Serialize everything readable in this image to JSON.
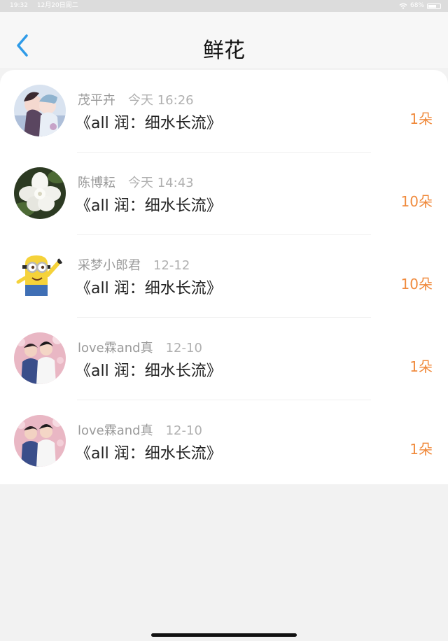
{
  "status_bar": {
    "time": "19:32",
    "date": "12月20日周二",
    "battery": "68%",
    "battery_level": 0.68
  },
  "nav": {
    "title": "鲜花"
  },
  "gifts": [
    {
      "user": "茂平卉",
      "time": "今天 16:26",
      "book": "《all 润：细水长流》",
      "count": "1朵",
      "avatar": "anime-couple-avatar"
    },
    {
      "user": "陈博耘",
      "time": "今天 14:43",
      "book": "《all 润：细水长流》",
      "count": "10朵",
      "avatar": "white-flower-avatar"
    },
    {
      "user": "采梦小郎君",
      "time": "12-12",
      "book": "《all 润：细水长流》",
      "count": "10朵",
      "avatar": "minion-avatar"
    },
    {
      "user": "love霖and真",
      "time": "12-10",
      "book": "《all 润：细水长流》",
      "count": "1朵",
      "avatar": "couple-photo-avatar"
    },
    {
      "user": "love霖and真",
      "time": "12-10",
      "book": "《all 润：细水长流》",
      "count": "1朵",
      "avatar": "couple-photo-avatar"
    }
  ],
  "colors": {
    "accent": "#f08a3c",
    "back": "#2f9be8"
  }
}
